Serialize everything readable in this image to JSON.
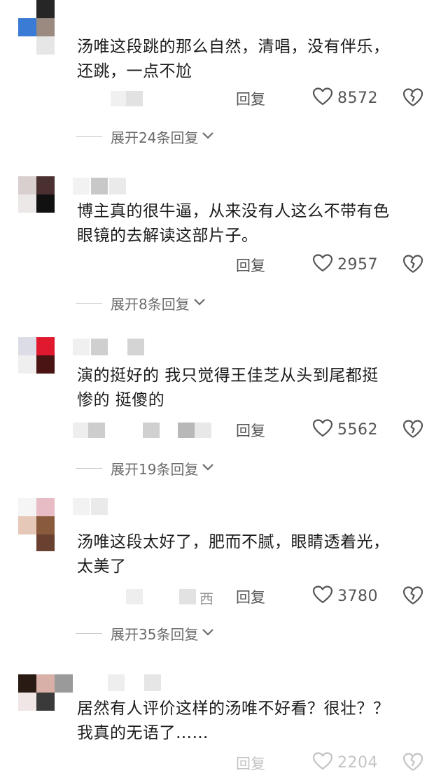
{
  "comments": [
    {
      "text_line1": "汤唯这段跳的那么自然，清唱，没有伴乐，",
      "text_line2": "还跳，一点不尬",
      "meta_suffix": "",
      "reply_label": "回复",
      "likes": "8572",
      "expand_label": "展开24条回复"
    },
    {
      "text_line1": "博主真的很牛逼，从来没有人这么不带有色",
      "text_line2": "眼镜的去解读这部片子。",
      "meta_suffix": "",
      "reply_label": "回复",
      "likes": "2957",
      "expand_label": "展开8条回复"
    },
    {
      "text_line1": "演的挺好的  我只觉得王佳芝从头到尾都挺",
      "text_line2": "惨的 挺傻的",
      "meta_suffix": "",
      "reply_label": "回复",
      "likes": "5562",
      "expand_label": "展开19条回复"
    },
    {
      "text_line1": "汤唯这段太好了，肥而不腻，眼睛透着光，",
      "text_line2": "太美了",
      "meta_suffix": "西",
      "reply_label": "回复",
      "likes": "3780",
      "expand_label": "展开35条回复"
    },
    {
      "text_line1": "居然有人评价这样的汤唯不好看？很壮？？",
      "text_line2": "我真的无语了……",
      "meta_suffix": "",
      "reply_label": "回复",
      "likes": "2204",
      "expand_label": ""
    }
  ],
  "colors": {
    "text": "#1c1c1c",
    "meta": "#555555",
    "expand": "#6b6b6b",
    "accent_avatar_blue": "#3a7bd5",
    "accent_avatar_red": "#e0192e"
  },
  "icons": {
    "like": "heart-outline-icon",
    "dislike": "broken-heart-icon",
    "expand": "chevron-down-icon"
  }
}
